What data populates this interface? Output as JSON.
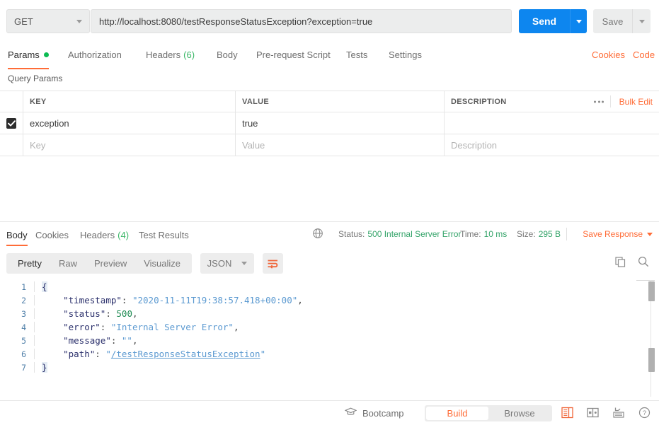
{
  "request": {
    "method": "GET",
    "method_caret_icon": "chevron-down-icon",
    "url": "http://localhost:8080/testResponseStatusException?exception=true",
    "send_label": "Send",
    "save_label": "Save"
  },
  "request_tabs": [
    {
      "label": "Params",
      "badge": "",
      "has_dot": true,
      "active": true
    },
    {
      "label": "Authorization",
      "badge": "",
      "has_dot": false,
      "active": false
    },
    {
      "label": "Headers",
      "badge": "(6)",
      "has_dot": false,
      "active": false
    },
    {
      "label": "Body",
      "badge": "",
      "has_dot": false,
      "active": false
    },
    {
      "label": "Pre-request Script",
      "badge": "",
      "has_dot": false,
      "active": false
    },
    {
      "label": "Tests",
      "badge": "",
      "has_dot": false,
      "active": false
    },
    {
      "label": "Settings",
      "badge": "",
      "has_dot": false,
      "active": false
    }
  ],
  "request_links": {
    "cookies": "Cookies",
    "code": "Code"
  },
  "params": {
    "section_title": "Query Params",
    "columns": [
      "KEY",
      "VALUE",
      "DESCRIPTION"
    ],
    "bulk_edit_label": "Bulk Edit",
    "more_icon": "ellipsis-icon",
    "rows": [
      {
        "checked": true,
        "key": "exception",
        "value": "true",
        "description": ""
      }
    ],
    "placeholder_row": {
      "key": "Key",
      "value": "Value",
      "description": "Description"
    }
  },
  "response_tabs": [
    {
      "label": "Body",
      "badge": "",
      "active": true
    },
    {
      "label": "Cookies",
      "badge": "",
      "active": false
    },
    {
      "label": "Headers",
      "badge": "(4)",
      "active": false
    },
    {
      "label": "Test Results",
      "badge": "",
      "active": false
    }
  ],
  "response_meta": {
    "globe_icon": "globe-icon",
    "status_label": "Status:",
    "status_value": "500 Internal Server Error",
    "time_label": "Time:",
    "time_value": "10 ms",
    "size_label": "Size:",
    "size_value": "295 B",
    "save_response_label": "Save Response",
    "save_response_caret_icon": "chevron-down-icon"
  },
  "body_toolbar": {
    "views": [
      "Pretty",
      "Raw",
      "Preview",
      "Visualize"
    ],
    "active_view": "Pretty",
    "language": "JSON",
    "language_caret_icon": "chevron-down-icon",
    "wrap_icon": "word-wrap-icon",
    "copy_icon": "copy-icon",
    "search_icon": "search-icon"
  },
  "body_code": {
    "lines": [
      {
        "num": "1",
        "tokens": [
          {
            "t": "{",
            "c": "brace"
          }
        ]
      },
      {
        "num": "2",
        "tokens": [
          {
            "t": "    ",
            "c": "p"
          },
          {
            "t": "\"timestamp\"",
            "c": "k"
          },
          {
            "t": ": ",
            "c": "p"
          },
          {
            "t": "\"2020-11-11T19:38:57.418+00:00\"",
            "c": "s"
          },
          {
            "t": ",",
            "c": "p"
          }
        ]
      },
      {
        "num": "3",
        "tokens": [
          {
            "t": "    ",
            "c": "p"
          },
          {
            "t": "\"status\"",
            "c": "k"
          },
          {
            "t": ": ",
            "c": "p"
          },
          {
            "t": "500",
            "c": "n"
          },
          {
            "t": ",",
            "c": "p"
          }
        ]
      },
      {
        "num": "4",
        "tokens": [
          {
            "t": "    ",
            "c": "p"
          },
          {
            "t": "\"error\"",
            "c": "k"
          },
          {
            "t": ": ",
            "c": "p"
          },
          {
            "t": "\"Internal Server Error\"",
            "c": "s"
          },
          {
            "t": ",",
            "c": "p"
          }
        ]
      },
      {
        "num": "5",
        "tokens": [
          {
            "t": "    ",
            "c": "p"
          },
          {
            "t": "\"message\"",
            "c": "k"
          },
          {
            "t": ": ",
            "c": "p"
          },
          {
            "t": "\"\"",
            "c": "s"
          },
          {
            "t": ",",
            "c": "p"
          }
        ]
      },
      {
        "num": "6",
        "tokens": [
          {
            "t": "    ",
            "c": "p"
          },
          {
            "t": "\"path\"",
            "c": "k"
          },
          {
            "t": ": ",
            "c": "p"
          },
          {
            "t": "\"",
            "c": "s"
          },
          {
            "t": "/testResponseStatusException",
            "c": "u"
          },
          {
            "t": "\"",
            "c": "s"
          }
        ]
      },
      {
        "num": "7",
        "tokens": [
          {
            "t": "}",
            "c": "brace"
          }
        ]
      }
    ]
  },
  "footer": {
    "bootcamp_label": "Bootcamp",
    "bootcamp_icon": "graduation-cap-icon",
    "modes": [
      "Build",
      "Browse"
    ],
    "active_mode": "Build",
    "icons": [
      "sidebar-layout-icon",
      "two-pane-layout-icon",
      "keyboard-shortcuts-icon",
      "help-icon"
    ]
  },
  "colors": {
    "accent_orange": "#ff6c37",
    "send_blue": "#0d86ef",
    "status_green": "#35a46a",
    "dot_green": "#0cbb52"
  }
}
